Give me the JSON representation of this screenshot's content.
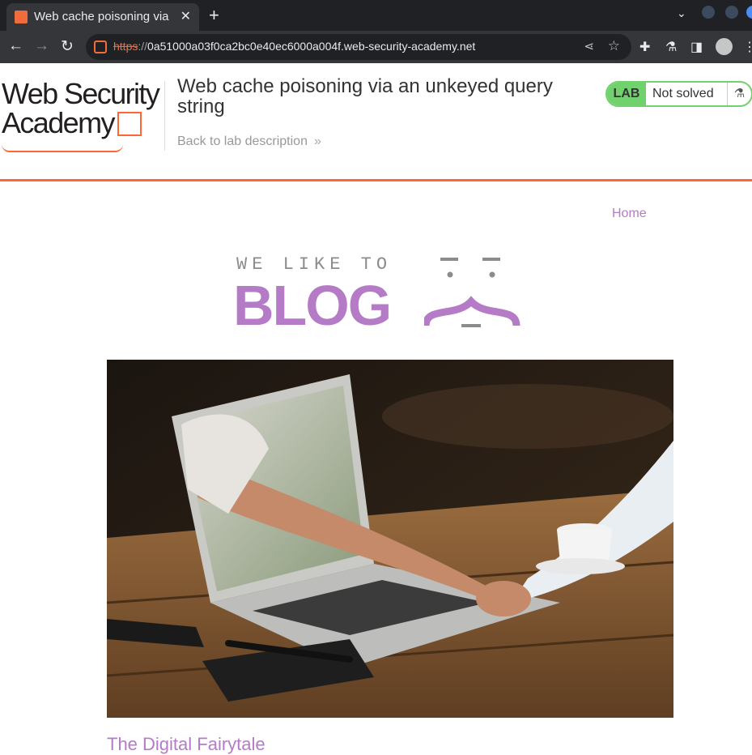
{
  "browser": {
    "tab_title": "Web cache poisoning via an unkeyed query string",
    "new_tab_symbol": "+",
    "url_scheme": "https",
    "url_rest": "0a51000a03f0ca2bc0e40ec6000a004f.web-security-academy.net"
  },
  "header": {
    "logo_line1": "Web Security",
    "logo_line2": "Academy",
    "lab_title": "Web cache poisoning via an unkeyed query string",
    "back_link": "Back to lab description",
    "status_badge": "LAB",
    "status_text": "Not solved"
  },
  "nav": {
    "home": "Home"
  },
  "blog_logo": {
    "tagline": "WE LIKE TO",
    "word": "BLOG"
  },
  "posts": [
    {
      "title": "The Digital Fairytale"
    }
  ],
  "colors": {
    "accent_orange": "#ff6633",
    "blog_purple": "#b57bc6",
    "status_green": "#70d16d"
  }
}
